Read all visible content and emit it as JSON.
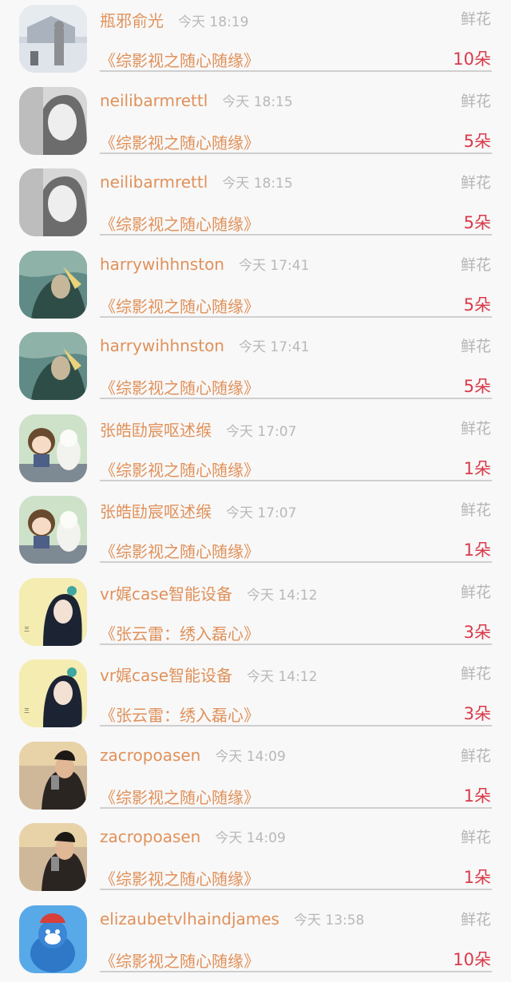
{
  "gift_label": "鲜花",
  "rows": [
    {
      "user": "瓶邪俞光",
      "time": "今天 18:19",
      "book": "《综影视之随心随缘》",
      "count": "10朵",
      "avatar": "winter-castle-avatar",
      "avatar_colors": [
        "#cfd6de",
        "#8d8f92"
      ]
    },
    {
      "user": "neilibarmrettl",
      "time": "今天 18:15",
      "book": "《综影视之随心随缘》",
      "count": "5朵",
      "avatar": "grayscale-girl-avatar",
      "avatar_colors": [
        "#d7d7d7",
        "#6c6c6c"
      ]
    },
    {
      "user": "neilibarmrettl",
      "time": "今天 18:15",
      "book": "《综影视之随心随缘》",
      "count": "5朵",
      "avatar": "grayscale-girl-avatar",
      "avatar_colors": [
        "#d7d7d7",
        "#6c6c6c"
      ]
    },
    {
      "user": "harrywihhnston",
      "time": "今天 17:41",
      "book": "《综影视之随心随缘》",
      "count": "5朵",
      "avatar": "teal-figure-avatar",
      "avatar_colors": [
        "#5f8a86",
        "#2f4d47"
      ]
    },
    {
      "user": "harrywihhnston",
      "time": "今天 17:41",
      "book": "《综影视之随心随缘》",
      "count": "5朵",
      "avatar": "teal-figure-avatar",
      "avatar_colors": [
        "#5f8a86",
        "#2f4d47"
      ]
    },
    {
      "user": "张皓劻宸呕述缑",
      "time": "今天 17:07",
      "book": "《综影视之随心随缘》",
      "count": "1朵",
      "avatar": "figurine-dog-avatar",
      "avatar_colors": [
        "#cde2c9",
        "#6a4a2e"
      ]
    },
    {
      "user": "张皓劻宸呕述缑",
      "time": "今天 17:07",
      "book": "《综影视之随心随缘》",
      "count": "1朵",
      "avatar": "figurine-dog-avatar",
      "avatar_colors": [
        "#cde2c9",
        "#6a4a2e"
      ]
    },
    {
      "user": "vr娓case智能设备",
      "time": "今天 14:12",
      "book": "《张云雷：绣入磊心》",
      "count": "3朵",
      "avatar": "yellow-girl-avatar",
      "avatar_colors": [
        "#f4ecb0",
        "#1c2433"
      ]
    },
    {
      "user": "vr娓case智能设备",
      "time": "今天 14:12",
      "book": "《张云雷：绣入磊心》",
      "count": "3朵",
      "avatar": "yellow-girl-avatar",
      "avatar_colors": [
        "#f4ecb0",
        "#1c2433"
      ]
    },
    {
      "user": "zacropoasen",
      "time": "今天 14:09",
      "book": "《综影视之随心随缘》",
      "count": "1朵",
      "avatar": "selfie-man-avatar",
      "avatar_colors": [
        "#cfb89a",
        "#2b2522"
      ]
    },
    {
      "user": "zacropoasen",
      "time": "今天 14:09",
      "book": "《综影视之随心随缘》",
      "count": "1朵",
      "avatar": "selfie-man-avatar",
      "avatar_colors": [
        "#cfb89a",
        "#2b2522"
      ]
    },
    {
      "user": "elizaubetvlhaindjames",
      "time": "今天 13:58",
      "book": "《综影视之随心随缘》",
      "count": "10朵",
      "avatar": "blue-mascot-avatar",
      "avatar_colors": [
        "#58a9e8",
        "#d73f3a"
      ]
    }
  ]
}
